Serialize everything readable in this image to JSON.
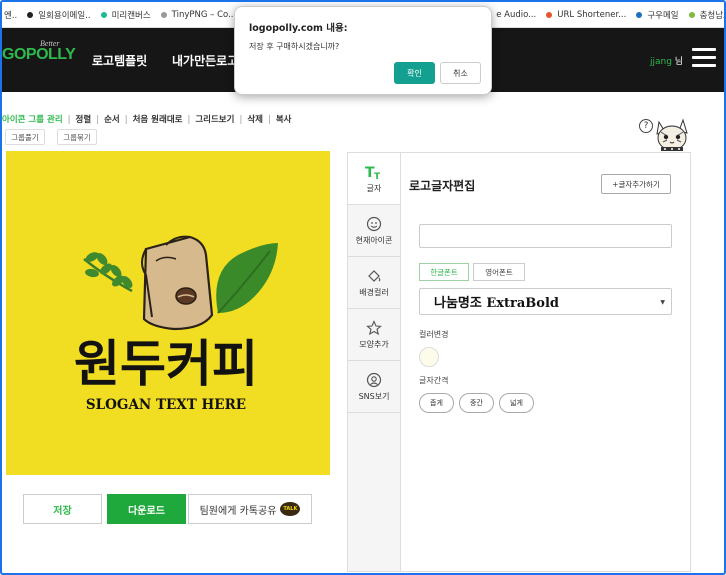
{
  "bookmarks": [
    {
      "label": "엔..",
      "color": "#777777"
    },
    {
      "label": "일회용이메일..",
      "color": "#222222"
    },
    {
      "label": "미리캔버스",
      "color": "#1db98f"
    },
    {
      "label": "TinyPNG – Co...",
      "color": "#999999"
    },
    {
      "label": "e Audio...",
      "color": ""
    },
    {
      "label": "URL Shortener...",
      "color": "#e4572e"
    },
    {
      "label": "구우메일",
      "color": "#1e6fbf"
    },
    {
      "label": "충청남도교육...",
      "color": "#7dbb3a"
    }
  ],
  "header": {
    "logo": "GOPOLLY",
    "logo_small": "Better",
    "nav": [
      "로고템플릿",
      "내가만든로고"
    ],
    "user_id": "jjang",
    "user_suffix": " 님"
  },
  "toolbar": {
    "items": [
      "아이콘 그룹 관리",
      "정렬",
      "순서",
      "처음 원래대로",
      "그리드보기",
      "삭제",
      "복사"
    ],
    "group_on": "그룹풀기",
    "group_off": "그룹묶기"
  },
  "logo_design": {
    "title": "원두커피",
    "slogan": "SLOGAN TEXT HERE",
    "background": "#f1dd21"
  },
  "actions": {
    "save": "저장",
    "download": "다운로드",
    "share": "팀원에게 카톡공유",
    "talk_badge": "TALK"
  },
  "help": "?",
  "side_tabs": [
    {
      "label": "글자",
      "icon": "text-icon",
      "active": true
    },
    {
      "label": "현재아이콘",
      "icon": "smiley-icon",
      "active": false
    },
    {
      "label": "배경컬러",
      "icon": "paint-bucket-icon",
      "active": false
    },
    {
      "label": "모양추가",
      "icon": "star-icon",
      "active": false
    },
    {
      "label": "SNS보기",
      "icon": "at-icon",
      "active": false
    }
  ],
  "panel": {
    "title": "로고글자편집",
    "add_text": "+글자추가하기",
    "text_value": "",
    "font_tabs": [
      "한글폰트",
      "영어폰트"
    ],
    "selected_font": "나눔명조 ExtraBold",
    "color_label": "컬러변경",
    "color_value": "#fdfbea",
    "spacing_label": "글자간격",
    "spacing_options": [
      "좁게",
      "중간",
      "넓게"
    ]
  },
  "dialog": {
    "title": "logopolly.com 내용:",
    "message": "저장 후 구매하시겠습니까?",
    "ok": "확인",
    "cancel": "취소"
  },
  "colors": {
    "brand_green": "#2fb94d",
    "download_green": "#1fa83c",
    "dialog_ok": "#14a090",
    "header_bg": "#161616"
  }
}
